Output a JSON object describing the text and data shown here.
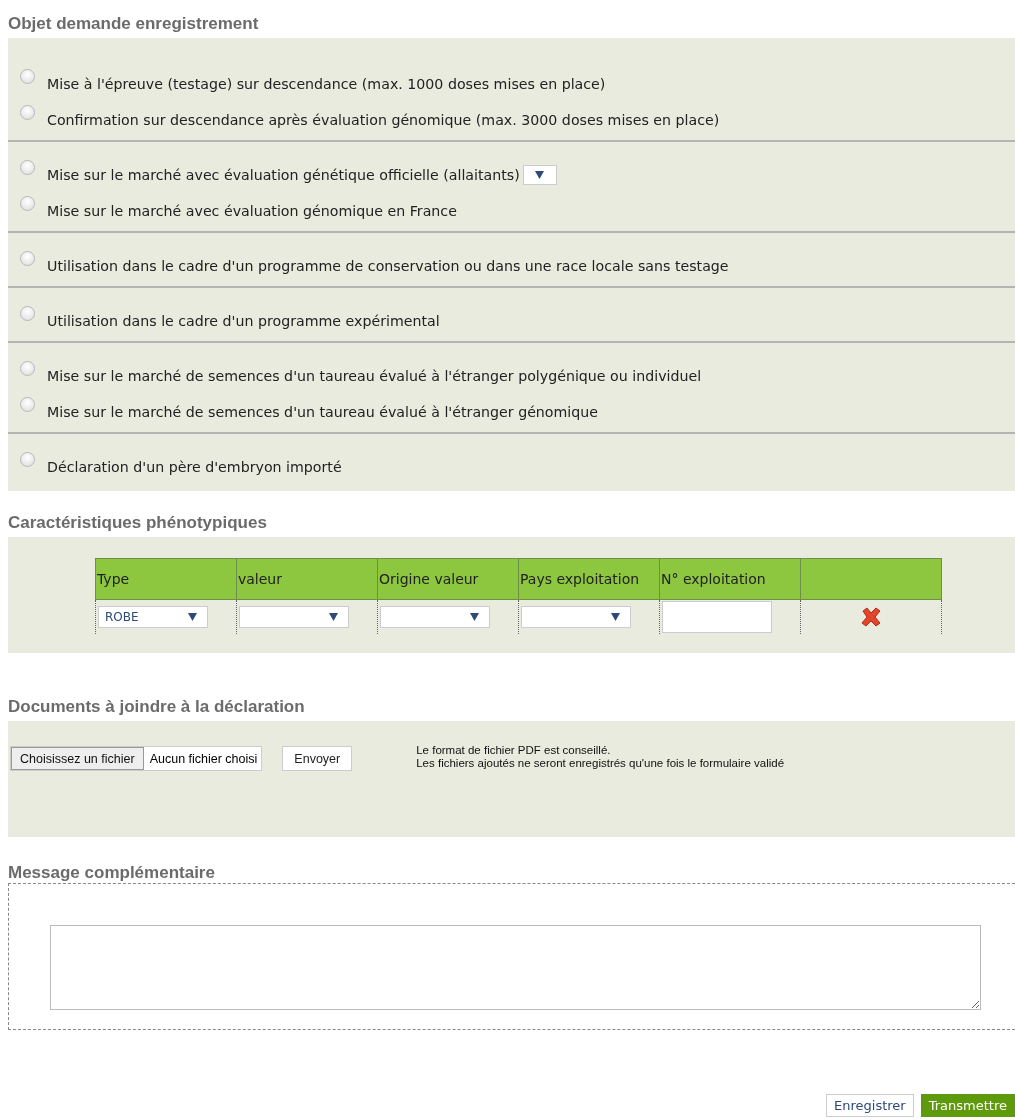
{
  "objet": {
    "title": "Objet demande enregistrement",
    "groups": [
      {
        "options": [
          {
            "kind": "radio",
            "label": "Mise à l'épreuve (testage) sur descendance (max. 1000 doses mises en place)",
            "selected": false
          },
          {
            "kind": "radio",
            "label": "Confirmation sur descendance après évaluation génomique (max. 3000 doses mises en place)",
            "selected": false
          }
        ]
      },
      {
        "options": [
          {
            "kind": "radio-select",
            "label": "Mise sur le marché avec évaluation génétique officielle (allaitants)",
            "selected": false
          },
          {
            "kind": "radio",
            "label": "Mise sur le marché avec évaluation génomique en France",
            "selected": false
          }
        ]
      },
      {
        "options": [
          {
            "kind": "radio",
            "label": "Utilisation dans le cadre d'un programme de conservation ou dans une race locale sans testage",
            "selected": false
          }
        ]
      },
      {
        "options": [
          {
            "kind": "radio",
            "label": "Utilisation dans le cadre d'un programme expérimental",
            "selected": false
          }
        ]
      },
      {
        "options": [
          {
            "kind": "radio",
            "label": "Mise sur le marché de semences d'un taureau évalué à l'étranger polygénique ou individuel",
            "selected": false
          },
          {
            "kind": "radio",
            "label": "Mise sur le marché de semences d'un taureau évalué à l'étranger génomique",
            "selected": false
          }
        ]
      },
      {
        "options": [
          {
            "kind": "radio",
            "label": "Déclaration d'un père d'embryon importé",
            "selected": false
          }
        ]
      }
    ]
  },
  "phenotypes": {
    "title": "Caractéristiques phénotypiques",
    "columns": [
      "Type",
      "valeur",
      "Origine valeur",
      "Pays exploitation",
      "N° exploitation"
    ],
    "rows": [
      {
        "cells": [
          {
            "kind": "select",
            "value": "ROBE"
          },
          {
            "kind": "select"
          },
          {
            "kind": "select"
          },
          {
            "kind": "select"
          },
          {
            "kind": "input"
          },
          {
            "kind": "delete"
          }
        ]
      }
    ]
  },
  "documents": {
    "title": "Documents à joindre à la déclaration",
    "file_button": "Choisissez un fichier",
    "file_status": "Aucun fichier choisi",
    "send_button": "Envoyer",
    "notes": [
      "Le format de fichier PDF est conseillé.",
      "Les fichiers ajoutés ne seront enregistrés qu'une fois le formulaire validé"
    ]
  },
  "message": {
    "title": "Message complémentaire"
  },
  "actions": [
    {
      "kind": "secondary",
      "label": "Enregistrer"
    },
    {
      "kind": "primary",
      "label": "Transmettre"
    }
  ]
}
